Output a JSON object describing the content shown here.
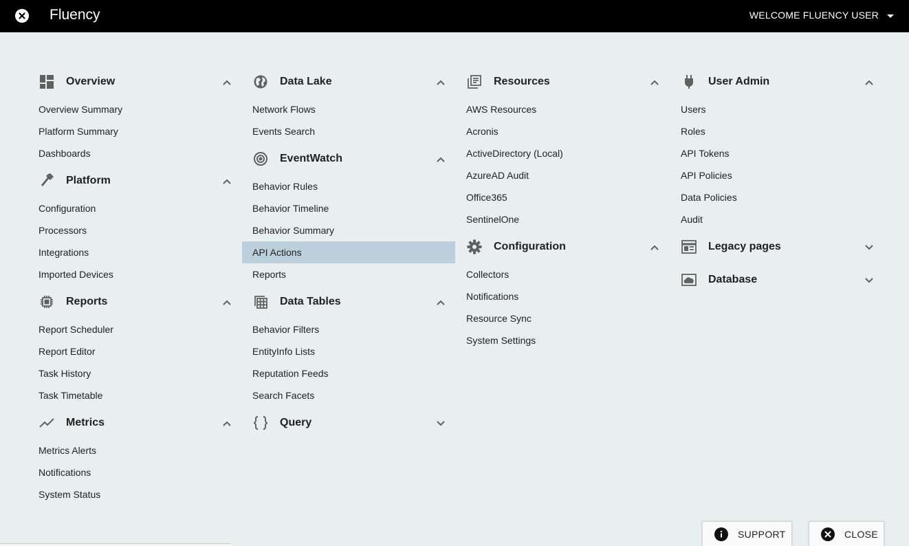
{
  "topbar": {
    "title": "Fluency",
    "welcome": "WELCOME FLUENCY USER"
  },
  "columns": [
    {
      "sections": [
        {
          "title": "Overview",
          "icon": "dashboard-icon",
          "expanded": true,
          "items": [
            "Overview Summary",
            "Platform Summary",
            "Dashboards"
          ]
        },
        {
          "title": "Platform",
          "icon": "hammer-icon",
          "expanded": true,
          "items": [
            "Configuration",
            "Processors",
            "Integrations",
            "Imported Devices"
          ]
        },
        {
          "title": "Reports",
          "icon": "chip-icon",
          "expanded": true,
          "items": [
            "Report Scheduler",
            "Report Editor",
            "Task History",
            "Task Timetable"
          ]
        },
        {
          "title": "Metrics",
          "icon": "trend-icon",
          "expanded": true,
          "items": [
            "Metrics Alerts",
            "Notifications",
            "System Status"
          ]
        }
      ]
    },
    {
      "sections": [
        {
          "title": "Data Lake",
          "icon": "globe-icon",
          "expanded": true,
          "items": [
            "Network Flows",
            "Events Search"
          ]
        },
        {
          "title": "EventWatch",
          "icon": "target-icon",
          "expanded": true,
          "items": [
            "Behavior Rules",
            "Behavior Timeline",
            "Behavior Summary",
            "API Actions",
            "Reports"
          ]
        },
        {
          "title": "Data Tables",
          "icon": "table-stack-icon",
          "expanded": true,
          "items": [
            "Behavior Filters",
            "EntityInfo Lists",
            "Reputation Feeds",
            "Search Facets"
          ]
        },
        {
          "title": "Query",
          "icon": "braces-icon",
          "expanded": false,
          "items": []
        }
      ]
    },
    {
      "sections": [
        {
          "title": "Resources",
          "icon": "library-icon",
          "expanded": true,
          "items": [
            "AWS Resources",
            "Acronis",
            "ActiveDirectory (Local)",
            "AzureAD Audit",
            "Office365",
            "SentinelOne"
          ]
        },
        {
          "title": "Configuration",
          "icon": "gear-icon",
          "expanded": true,
          "items": [
            "Collectors",
            "Notifications",
            "Resource Sync",
            "System Settings"
          ]
        }
      ]
    },
    {
      "sections": [
        {
          "title": "User Admin",
          "icon": "plug-icon",
          "expanded": true,
          "items": [
            "Users",
            "Roles",
            "API Tokens",
            "API Policies",
            "Data Policies",
            "Audit"
          ]
        },
        {
          "title": "Legacy pages",
          "icon": "web-layout-icon",
          "expanded": false,
          "items": []
        },
        {
          "title": "Database",
          "icon": "database-box-icon",
          "expanded": false,
          "items": []
        }
      ]
    }
  ],
  "active_item": "API Actions",
  "footer": {
    "support_label": "SUPPORT",
    "close_label": "CLOSE"
  }
}
